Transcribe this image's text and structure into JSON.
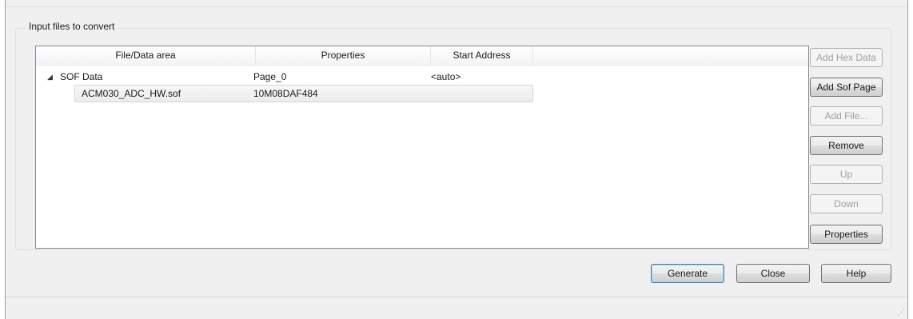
{
  "group": {
    "label": "Input files to convert"
  },
  "table": {
    "headers": [
      "File/Data area",
      "Properties",
      "Start Address"
    ],
    "rows": [
      {
        "file": "SOF Data",
        "properties": "Page_0",
        "start": "<auto>"
      },
      {
        "file": "ACM030_ADC_HW.sof",
        "properties": "10M08DAF484",
        "start": ""
      }
    ]
  },
  "side_buttons": {
    "add_hex_data": "Add Hex Data",
    "add_sof_page": "Add Sof Page",
    "add_file": "Add File...",
    "remove": "Remove",
    "up": "Up",
    "down": "Down",
    "properties": "Properties"
  },
  "bottom_buttons": {
    "generate": "Generate",
    "close": "Close",
    "help": "Help"
  },
  "icons": {
    "expander": "triangle-expanded-icon",
    "grip": "resize-grip-icon"
  }
}
